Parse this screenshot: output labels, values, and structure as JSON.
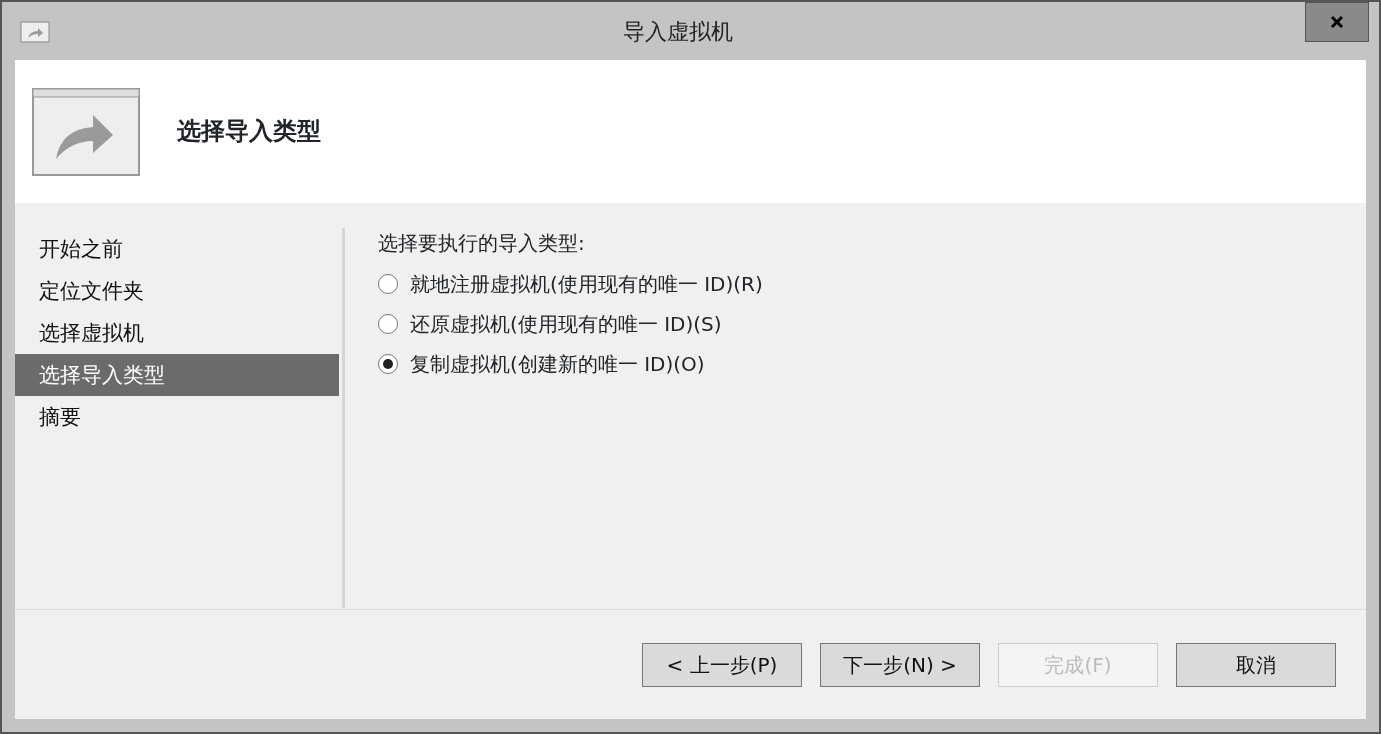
{
  "window": {
    "title": "导入虚拟机"
  },
  "header": {
    "title": "选择导入类型"
  },
  "steps": [
    {
      "label": "开始之前",
      "selected": false
    },
    {
      "label": "定位文件夹",
      "selected": false
    },
    {
      "label": "选择虚拟机",
      "selected": false
    },
    {
      "label": "选择导入类型",
      "selected": true
    },
    {
      "label": "摘要",
      "selected": false
    }
  ],
  "prompt": "选择要执行的导入类型:",
  "options": [
    {
      "label": "就地注册虚拟机(使用现有的唯一 ID)(R)",
      "selected": false
    },
    {
      "label": "还原虚拟机(使用现有的唯一 ID)(S)",
      "selected": false
    },
    {
      "label": "复制虚拟机(创建新的唯一 ID)(O)",
      "selected": true
    }
  ],
  "buttons": [
    {
      "label": "< 上一步(P)",
      "disabled": false
    },
    {
      "label": "下一步(N) >",
      "disabled": false
    },
    {
      "label": "完成(F)",
      "disabled": true
    },
    {
      "label": "取消",
      "disabled": false
    }
  ]
}
